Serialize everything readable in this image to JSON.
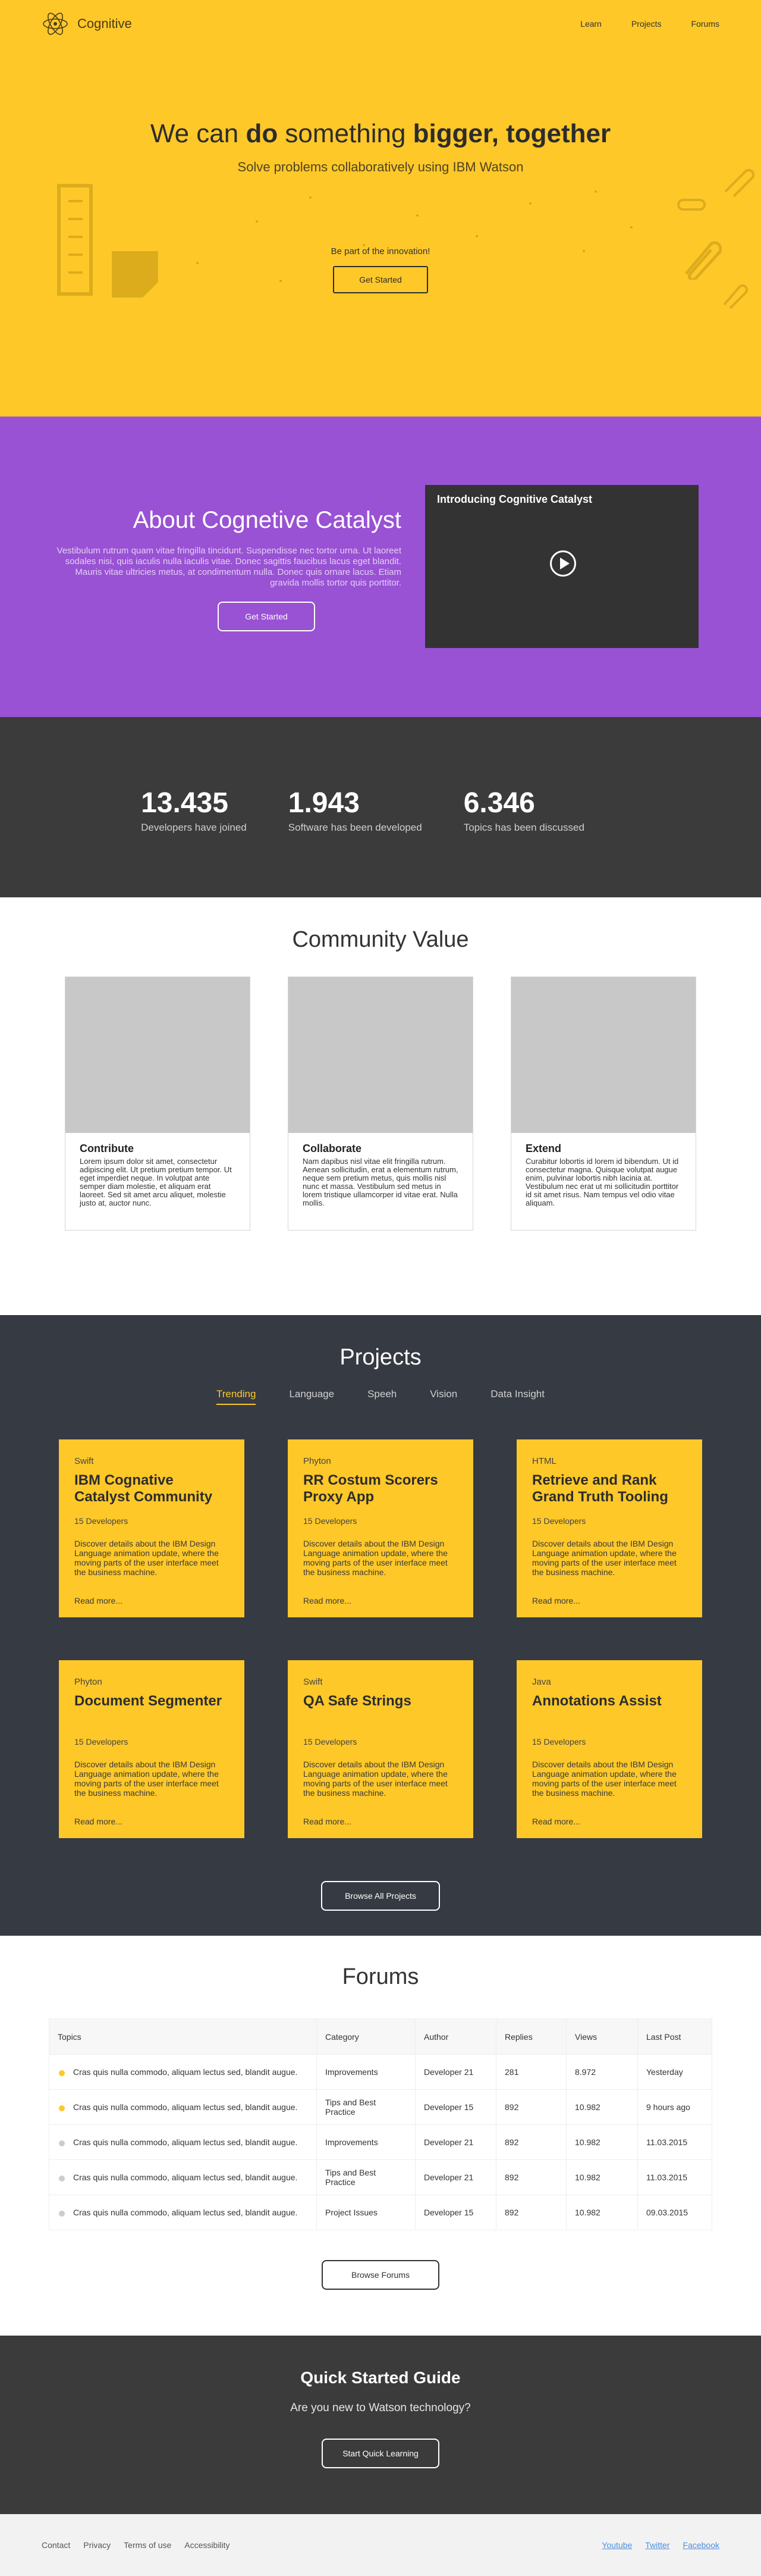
{
  "nav": {
    "brand": "Cognitive",
    "links": [
      "Learn",
      "Projects",
      "Forums"
    ]
  },
  "hero": {
    "title_pre": "We can ",
    "title_bold1": "do",
    "title_mid": " something ",
    "title_bold2": "bigger, together",
    "subtitle": "Solve problems collaboratively using IBM Watson",
    "cta_label": "Be part of the innovation!",
    "cta_button": "Get Started"
  },
  "about": {
    "title": "About Cognetive Catalyst",
    "body": "Vestibulum rutrum quam vitae fringilla tincidunt. Suspendisse nec tortor urna. Ut laoreet sodales nisi, quis iaculis nulla iaculis vitae. Donec sagittis faucibus lacus eget blandit. Mauris vitae ultricies metus, at condimentum nulla. Donec quis ornare lacus. Etiam gravida mollis tortor quis porttitor.",
    "button": "Get Started",
    "video_title": "Introducing Cognitive Catalyst"
  },
  "stats": [
    {
      "value": "13.435",
      "label": "Developers have joined"
    },
    {
      "value": "1.943",
      "label": "Software has been developed"
    },
    {
      "value": "6.346",
      "label": "Topics has been discussed"
    }
  ],
  "community": {
    "title": "Community Value",
    "cards": [
      {
        "title": "Contribute",
        "body": "Lorem ipsum dolor sit amet, consectetur adipiscing elit. Ut pretium pretium tempor. Ut eget imperdiet neque. In volutpat ante semper diam molestie, et aliquam erat laoreet. Sed sit amet arcu aliquet, molestie justo at, auctor nunc."
      },
      {
        "title": "Collaborate",
        "body": "Nam dapibus nisl vitae elit fringilla rutrum. Aenean sollicitudin, erat a elementum rutrum, neque sem pretium metus, quis mollis nisl nunc et massa. Vestibulum sed metus in lorem tristique ullamcorper id vitae erat. Nulla mollis."
      },
      {
        "title": "Extend",
        "body": "Curabitur lobortis id lorem id bibendum. Ut id consectetur magna. Quisque volutpat augue enim, pulvinar lobortis nibh lacinia at. Vestibulum nec erat ut mi sollicitudin porttitor id sit amet risus. Nam tempus vel odio vitae aliquam."
      }
    ]
  },
  "projects": {
    "title": "Projects",
    "tabs": [
      "Trending",
      "Language",
      "Speeh",
      "Vision",
      "Data Insight"
    ],
    "items": [
      {
        "lang": "Swift",
        "title": "IBM Cognative Catalyst Community",
        "devs": "15 Developers",
        "desc": "Discover details about the IBM Design Language animation update, where the moving parts of the user interface meet the business machine.",
        "more": "Read more..."
      },
      {
        "lang": "Phyton",
        "title": "RR Costum Scorers Proxy App",
        "devs": "15 Developers",
        "desc": "Discover details about the IBM Design Language animation update, where the moving parts of the user interface meet the business machine.",
        "more": "Read more..."
      },
      {
        "lang": "HTML",
        "title": "Retrieve and Rank Grand Truth Tooling",
        "devs": "15 Developers",
        "desc": "Discover details about the IBM Design Language animation update, where the moving parts of the user interface meet the business machine.",
        "more": "Read more..."
      },
      {
        "lang": "Phyton",
        "title": "Document Segmenter",
        "devs": "15 Developers",
        "desc": "Discover details about the IBM Design Language animation update, where the moving parts of the user interface meet the business machine.",
        "more": "Read more..."
      },
      {
        "lang": "Swift",
        "title": "QA Safe Strings",
        "devs": "15 Developers",
        "desc": "Discover details about the IBM Design Language animation update, where the moving parts of the user interface meet the business machine.",
        "more": "Read more..."
      },
      {
        "lang": "Java",
        "title": "Annotations Assist",
        "devs": "15 Developers",
        "desc": "Discover details about the IBM Design Language animation update, where the moving parts of the user interface meet the business machine.",
        "more": "Read more..."
      }
    ],
    "button": "Browse All Projects"
  },
  "forums": {
    "title": "Forums",
    "headers": [
      "Topics",
      "Category",
      "Author",
      "Replies",
      "Views",
      "Last Post"
    ],
    "rows": [
      {
        "topic": "Cras quis nulla commodo, aliquam lectus sed, blandit augue.",
        "category": "Improvements",
        "author": "Developer 21",
        "replies": "281",
        "views": "8.972",
        "last": "Yesterday",
        "color": "#fec829"
      },
      {
        "topic": "Cras quis nulla commodo, aliquam lectus sed, blandit augue.",
        "category": "Tips and Best Practice",
        "author": "Developer 15",
        "replies": "892",
        "views": "10.982",
        "last": "9 hours ago",
        "color": "#fec829"
      },
      {
        "topic": "Cras quis nulla commodo, aliquam lectus sed, blandit augue.",
        "category": "Improvements",
        "author": "Developer 21",
        "replies": "892",
        "views": "10.982",
        "last": "11.03.2015",
        "color": "#cccccc"
      },
      {
        "topic": "Cras quis nulla commodo, aliquam lectus sed, blandit augue.",
        "category": "Tips and Best Practice",
        "author": "Developer 21",
        "replies": "892",
        "views": "10.982",
        "last": "11.03.2015",
        "color": "#cccccc"
      },
      {
        "topic": "Cras quis nulla commodo, aliquam lectus sed, blandit augue.",
        "category": "Project Issues",
        "author": "Developer 15",
        "replies": "892",
        "views": "10.982",
        "last": "09.03.2015",
        "color": "#cccccc"
      }
    ],
    "button": "Browse Forums"
  },
  "guide": {
    "title": "Quick Started Guide",
    "subtitle": "Are you new to Watson technology?",
    "button": "Start Quick Learning"
  },
  "footer": {
    "left": [
      "Contact",
      "Privacy",
      "Terms of use",
      "Accessibility"
    ],
    "right": [
      "Youtube",
      "Twitter",
      "Facebook"
    ]
  }
}
